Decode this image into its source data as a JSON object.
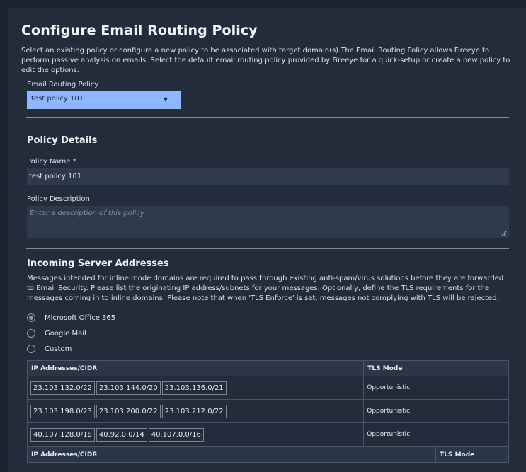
{
  "page": {
    "title": "Configure Email Routing Policy",
    "intro": "Select an existing policy or configure a new policy to be associated with target domain(s).The Email Routing Policy allows Fireeye to perform passive analysis on emails. Select the default email routing policy provided by Fireeye for a quick-setup or create a new policy to edit the options."
  },
  "routing": {
    "label": "Email Routing Policy",
    "selected": "test policy 101"
  },
  "details": {
    "heading": "Policy Details",
    "name_label": "Policy Name *",
    "name_value": "test policy 101",
    "desc_label": "Policy Description",
    "desc_placeholder": "Enter a description of this policy"
  },
  "incoming": {
    "heading": "Incoming Server Addresses",
    "description": "Messages intended for inline mode domains are required to pass through existing anti-spam/virus solutions before they are forwarded to Email Security. Please list the originating IP address/subnets for your messages. Optionally, define the TLS requirements for the messages coming in to inline domains. Please note that when 'TLS Enforce' is set, messages not complying with TLS will be rejected.",
    "options": [
      {
        "label": "Microsoft Office 365",
        "selected": true
      },
      {
        "label": "Google Mail",
        "selected": false
      },
      {
        "label": "Custom",
        "selected": false
      }
    ]
  },
  "table": {
    "col_ip": "IP Addresses/CIDR",
    "col_tls": "TLS Mode",
    "rows": [
      {
        "ips": [
          "23.103.132.0/22",
          "23.103.144.0/20",
          "23.103.136.0/21"
        ],
        "tls": "Opportunistic"
      },
      {
        "ips": [
          "23.103.198.0/23",
          "23.103.200.0/22",
          "23.103.212.0/22"
        ],
        "tls": "Opportunistic"
      },
      {
        "ips": [
          "40.107.128.0/18",
          "40.92.0.0/14",
          "40.107.0.0/16"
        ],
        "tls": "Opportunistic"
      }
    ]
  },
  "table2": {
    "col_ip": "IP Addresses/CIDR",
    "col_tls": "TLS Mode"
  }
}
